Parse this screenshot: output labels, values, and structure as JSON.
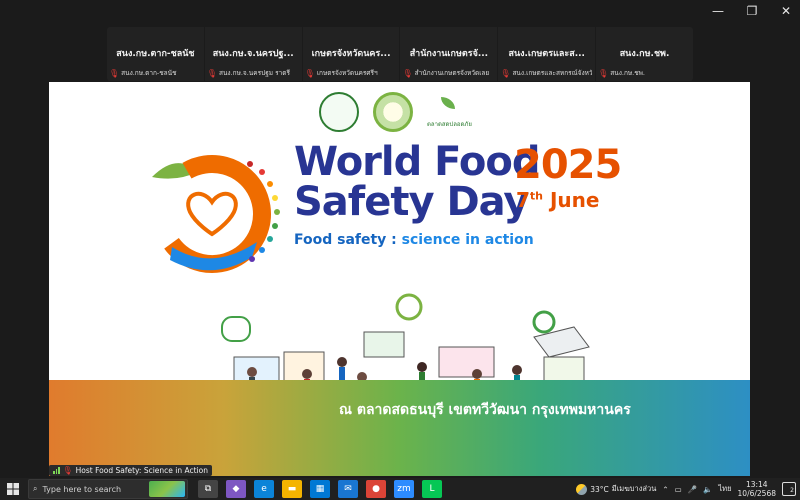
{
  "window": {
    "controls": [
      "—",
      "❐",
      "✕"
    ]
  },
  "gallery": [
    {
      "name": "สนง.กษ.ตาก-ชลนัช",
      "sub": "สนง.กษ.ตาก-ชลนัช"
    },
    {
      "name": "สนง.กษ.จ.นครปฐ...",
      "sub": "สนง.กษ.จ.นครปฐม ราตรี"
    },
    {
      "name": "เกษตรจังหวัดนคร...",
      "sub": "เกษตรจังหวัดนครศรีฯ"
    },
    {
      "name": "สำนักงานเกษตรจั...",
      "sub": "สำนักงานเกษตรจังหวัดเลย"
    },
    {
      "name": "สนง.เกษตรและส...",
      "sub": "สนง.เกษตรและสหกรณ์จังหวั..."
    },
    {
      "name": "สนง.กษ.ชพ.",
      "sub": "สนง.กษ.ชพ."
    }
  ],
  "poster": {
    "title_line1": "World Food",
    "title_line2": "Safety Day",
    "year": "2025",
    "date_day": "7",
    "date_suffix": "th",
    "date_month": "June",
    "tagline_a": "Food safety",
    "tagline_sep": " : ",
    "tagline_b": "science in action",
    "location": "ณ ตลาดสดธนบุรี เขตทวีวัฒนา กรุงเทพมหานคร",
    "logo3_text": "ตลาดสดปลอดภัย"
  },
  "caption": "Host Food Safety: Science in Action",
  "taskbar": {
    "search_placeholder": "Type here to search",
    "apps": [
      {
        "name": "task-view",
        "glyph": "⧉",
        "color": "#444"
      },
      {
        "name": "copilot",
        "glyph": "◆",
        "color": "#7e57c2"
      },
      {
        "name": "edge",
        "glyph": "e",
        "color": "#0b84d8"
      },
      {
        "name": "file-explorer",
        "glyph": "▬",
        "color": "#f4b400"
      },
      {
        "name": "store",
        "glyph": "▦",
        "color": "#0078d4"
      },
      {
        "name": "mail",
        "glyph": "✉",
        "color": "#1976d2"
      },
      {
        "name": "chrome",
        "glyph": "●",
        "color": "#db4437"
      },
      {
        "name": "zoom",
        "glyph": "zm",
        "color": "#2d8cff"
      },
      {
        "name": "line",
        "glyph": "L",
        "color": "#06c755"
      }
    ],
    "weather_temp": "33°C",
    "weather_desc": "มีเมฆบางส่วน",
    "lang": "ไทย",
    "time": "13:14",
    "date": "10/6/2568",
    "notifications": "2"
  }
}
